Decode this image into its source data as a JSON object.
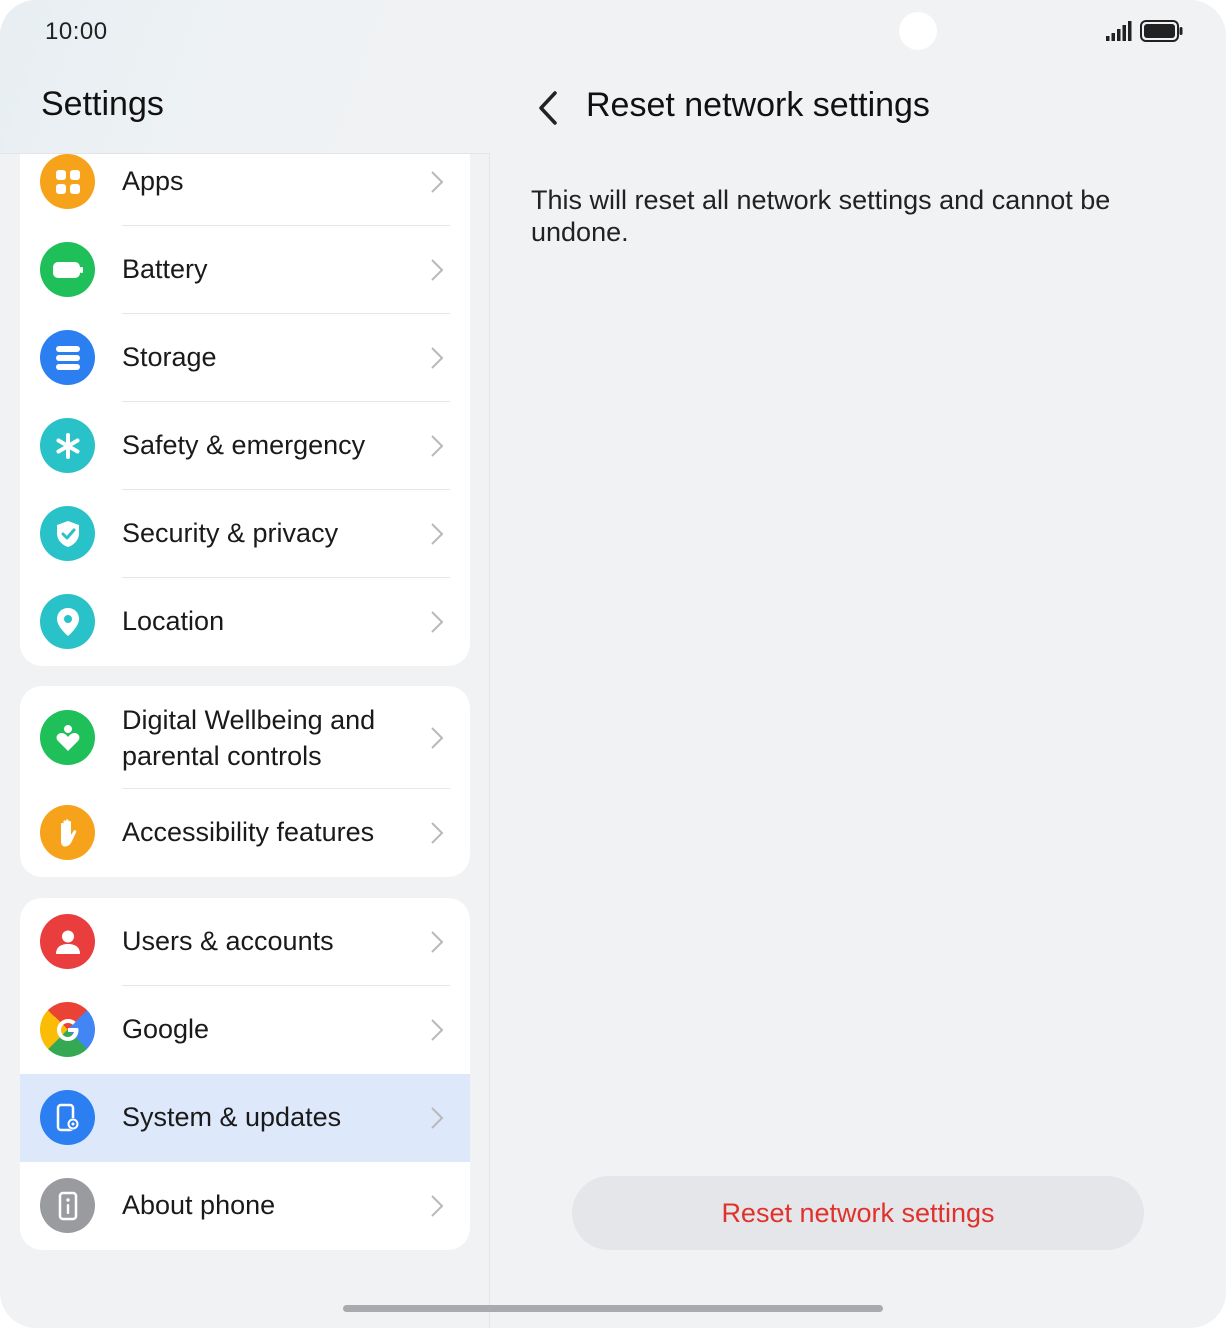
{
  "status_bar": {
    "time": "10:00"
  },
  "left_pane": {
    "title": "Settings",
    "groups": [
      {
        "items": [
          {
            "label": "Apps",
            "icon": "apps-icon",
            "color": "#f7a21b"
          },
          {
            "label": "Battery",
            "icon": "battery-icon",
            "color": "#1fbf5a"
          },
          {
            "label": "Storage",
            "icon": "storage-icon",
            "color": "#2b7ff0"
          },
          {
            "label": "Safety & emergency",
            "icon": "asterisk-icon",
            "color": "#29c2c8"
          },
          {
            "label": "Security & privacy",
            "icon": "shield-icon",
            "color": "#29c2c8"
          },
          {
            "label": "Location",
            "icon": "location-pin-icon",
            "color": "#29c2c8"
          }
        ]
      },
      {
        "items": [
          {
            "label": "Digital Wellbeing and parental controls",
            "icon": "wellbeing-icon",
            "color": "#1fbf5a"
          },
          {
            "label": "Accessibility features",
            "icon": "hand-icon",
            "color": "#f7a21b"
          }
        ]
      },
      {
        "items": [
          {
            "label": "Users & accounts",
            "icon": "user-icon",
            "color": "#ea3e3e"
          },
          {
            "label": "Google",
            "icon": "google-icon",
            "color": "#4285f4"
          },
          {
            "label": "System & updates",
            "icon": "phone-gear-icon",
            "color": "#2b7ff0",
            "selected": true
          },
          {
            "label": "About phone",
            "icon": "info-phone-icon",
            "color": "#9a9b9e"
          }
        ]
      }
    ]
  },
  "right_pane": {
    "title": "Reset network settings",
    "description": "This will reset all network settings and cannot be undone.",
    "action_button": "Reset network settings",
    "action_color": "#e0322c"
  }
}
